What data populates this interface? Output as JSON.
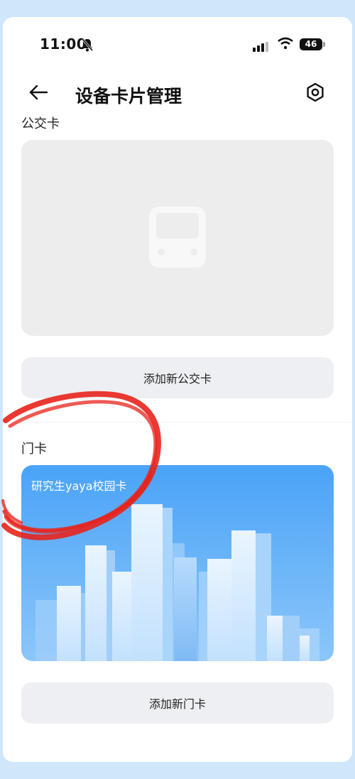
{
  "status_bar": {
    "time": "11:00",
    "battery": "46"
  },
  "header": {
    "title": "设备卡片管理"
  },
  "transit": {
    "section_label": "公交卡",
    "add_button_label": "添加新公交卡"
  },
  "door": {
    "section_label": "门卡",
    "card_name": "研究生yaya校园卡",
    "add_button_label": "添加新门卡"
  },
  "colors": {
    "card_gradient_start": "#5aa8f7",
    "card_gradient_end": "#3f97f3",
    "annotation": "#e8231c"
  },
  "icons": [
    "bell-mute-icon",
    "signal-icon",
    "wifi-icon",
    "battery-icon",
    "back-arrow-icon",
    "settings-icon",
    "bus-icon"
  ]
}
